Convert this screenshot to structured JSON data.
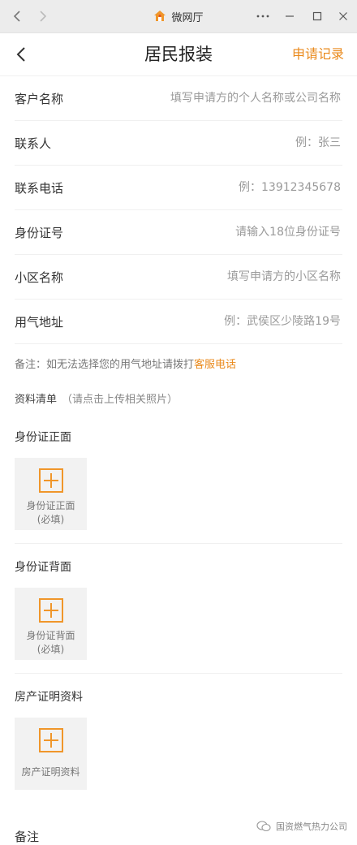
{
  "window": {
    "title": "微网厅",
    "icons": {
      "back": "arrow-left-icon",
      "forward": "arrow-right-icon",
      "more": "more-dots-icon",
      "minimize": "minimize-icon",
      "maximize": "maximize-icon",
      "close": "close-icon",
      "app": "home-icon"
    }
  },
  "header": {
    "title": "居民报装",
    "records_label": "申请记录",
    "accent_color": "#ea8a1c"
  },
  "form": {
    "fields": [
      {
        "label": "客户名称",
        "placeholder": "填写申请方的个人名称或公司名称",
        "value": ""
      },
      {
        "label": "联系人",
        "placeholder": "例：张三",
        "value": ""
      },
      {
        "label": "联系电话",
        "placeholder": "例：13912345678",
        "value": ""
      },
      {
        "label": "身份证号",
        "placeholder": "请输入18位身份证号",
        "value": ""
      },
      {
        "label": "小区名称",
        "placeholder": "填写申请方的小区名称",
        "value": ""
      },
      {
        "label": "用气地址",
        "placeholder": "例：武侯区少陵路19号",
        "value": ""
      }
    ],
    "note_prefix": "备注：如无法选择您的用气地址请拨打",
    "note_link": "客服电话"
  },
  "materials": {
    "title": "资料清单",
    "hint": "（请点击上传相关照片）",
    "sections": [
      {
        "title": "身份证正面",
        "label_line1": "身份证正面",
        "label_line2": "(必填)"
      },
      {
        "title": "身份证背面",
        "label_line1": "身份证背面",
        "label_line2": "(必填)"
      },
      {
        "title": "房产证明资料",
        "label_line1": "房产证明资料",
        "label_line2": ""
      }
    ]
  },
  "remark": {
    "label": "备注"
  },
  "watermark": {
    "text": "国资燃气热力公司"
  }
}
